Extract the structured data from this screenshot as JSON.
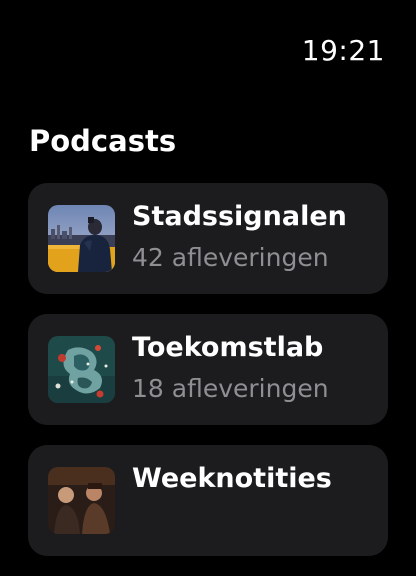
{
  "status_bar": {
    "time": "19:21"
  },
  "page": {
    "title": "Podcasts"
  },
  "podcasts": [
    {
      "title": "Stadssignalen",
      "episodes": "42 afleveringen",
      "artwork_icon": "city-evening-portrait-artwork"
    },
    {
      "title": "Toekomstlab",
      "episodes": "18 afleveringen",
      "artwork_icon": "abstract-map-artwork"
    },
    {
      "title": "Weeknotities",
      "episodes": "",
      "artwork_icon": "interview-scene-artwork"
    }
  ],
  "colors": {
    "background": "#000000",
    "card": "#1c1c1e",
    "primary_text": "#ffffff",
    "secondary_text": "#8e8e93"
  }
}
